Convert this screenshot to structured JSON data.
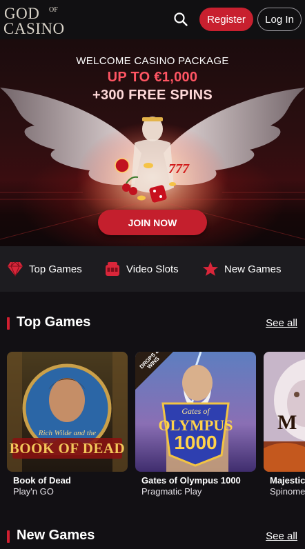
{
  "header": {
    "logo_text_top": "GOD",
    "logo_text_of": "OF",
    "logo_text_bottom": "CASINO",
    "register_label": "Register",
    "login_label": "Log In",
    "search_icon": "search-icon"
  },
  "hero": {
    "line1": "WELCOME CASINO PACKAGE",
    "line2": "UP TO €1,000",
    "line3": "+300 FREE SPINS",
    "cta_label": "JOIN NOW",
    "colors": {
      "accent": "#c41f2d",
      "highlight": "#ff5563"
    }
  },
  "categories": [
    {
      "label": "Top Games",
      "icon": "diamond-icon"
    },
    {
      "label": "Video Slots",
      "icon": "slot-machine-icon"
    },
    {
      "label": "New Games",
      "icon": "star-icon"
    }
  ],
  "top_games": {
    "title": "Top Games",
    "see_all": "See all",
    "games": [
      {
        "name": "Book of Dead",
        "provider": "Play'n GO",
        "art_text": "BOOK OF DEAD",
        "art_sub": "Rich Wilde and the"
      },
      {
        "name": "Gates of Olympus 1000",
        "provider": "Pragmatic Play",
        "art_text": "OLYMPUS",
        "art_sub": "Gates of",
        "art_num": "1000",
        "badge": "DROPS & WINS"
      },
      {
        "name": "Majestic",
        "provider": "Spinome",
        "art_text": "M"
      }
    ]
  },
  "new_games": {
    "title": "New Games",
    "see_all": "See all"
  }
}
